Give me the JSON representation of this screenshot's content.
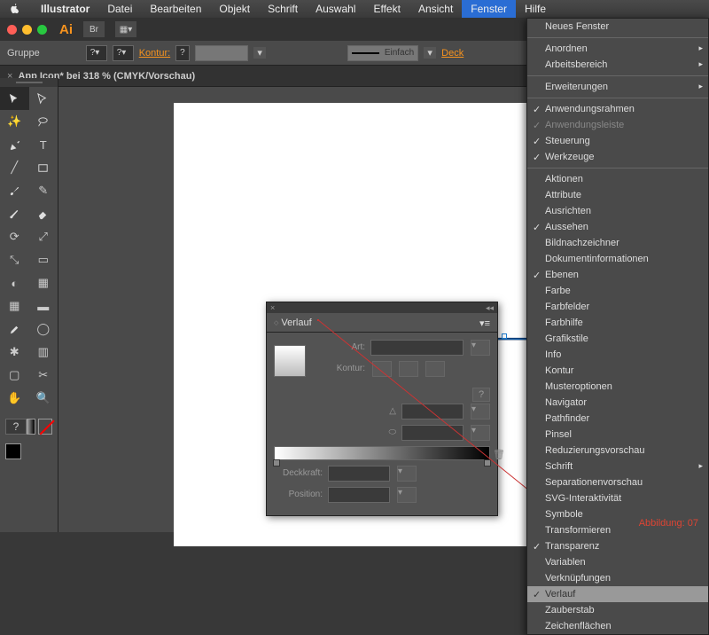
{
  "menubar": {
    "items": [
      "Illustrator",
      "Datei",
      "Bearbeiten",
      "Objekt",
      "Schrift",
      "Auswahl",
      "Effekt",
      "Ansicht",
      "Fenster",
      "Hilfe"
    ],
    "active": "Fenster"
  },
  "controlbar": {
    "group": "Gruppe",
    "kontur": "Kontur:",
    "einfach": "Einfach",
    "deckk": "Deck"
  },
  "tab": {
    "close": "×",
    "title": "App Icon* bei 318 % (CMYK/Vorschau)"
  },
  "panel": {
    "title": "Verlauf",
    "art": "Art:",
    "kontur": "Kontur:",
    "deckkraft": "Deckkraft:",
    "position": "Position:"
  },
  "fenster_menu": {
    "top": [
      {
        "label": "Neues Fenster"
      },
      {
        "sep": true
      },
      {
        "label": "Anordnen",
        "sub": true
      },
      {
        "label": "Arbeitsbereich",
        "sub": true
      },
      {
        "sep": true
      },
      {
        "label": "Erweiterungen",
        "sub": true
      },
      {
        "sep": true
      },
      {
        "label": "Anwendungsrahmen",
        "chk": true
      },
      {
        "label": "Anwendungsleiste",
        "chk": true,
        "dis": true
      },
      {
        "label": "Steuerung",
        "chk": true
      },
      {
        "label": "Werkzeuge",
        "chk": true
      },
      {
        "sep": true
      },
      {
        "label": "Aktionen"
      },
      {
        "label": "Attribute"
      },
      {
        "label": "Ausrichten"
      },
      {
        "label": "Aussehen",
        "chk": true
      },
      {
        "label": "Bildnachzeichner"
      },
      {
        "label": "Dokumentinformationen"
      },
      {
        "label": "Ebenen",
        "chk": true
      },
      {
        "label": "Farbe"
      },
      {
        "label": "Farbfelder"
      },
      {
        "label": "Farbhilfe"
      },
      {
        "label": "Grafikstile"
      },
      {
        "label": "Info"
      },
      {
        "label": "Kontur"
      },
      {
        "label": "Musteroptionen"
      },
      {
        "label": "Navigator"
      },
      {
        "label": "Pathfinder"
      },
      {
        "label": "Pinsel"
      },
      {
        "label": "Reduzierungsvorschau"
      },
      {
        "label": "Schrift",
        "sub": true
      },
      {
        "label": "Separationenvorschau"
      },
      {
        "label": "SVG-Interaktivität"
      },
      {
        "label": "Symbole"
      },
      {
        "label": "Transformieren"
      },
      {
        "label": "Transparenz",
        "chk": true
      },
      {
        "label": "Variablen"
      },
      {
        "label": "Verknüpfungen"
      },
      {
        "label": "Verlauf",
        "chk": true,
        "hl": true
      },
      {
        "label": "Zauberstab"
      },
      {
        "label": "Zeichenflächen"
      }
    ]
  },
  "caption": "Abbildung: 07"
}
